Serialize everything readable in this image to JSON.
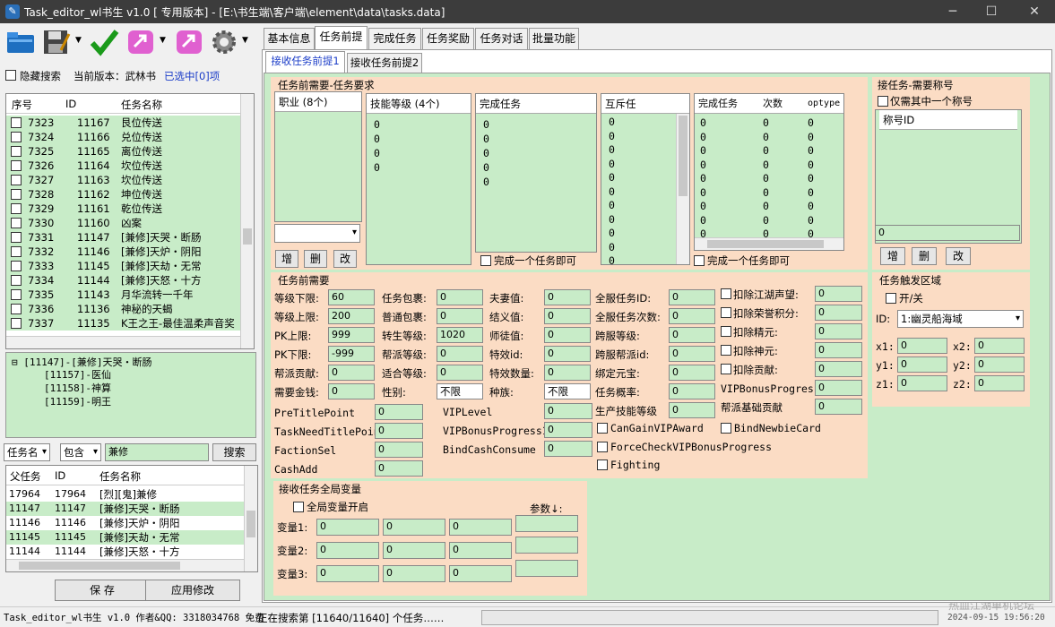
{
  "window": {
    "title": "Task_editor_wl书生 v1.0 [ 专用版本] - [E:\\书生端\\客户端\\element\\data\\tasks.data]",
    "min": "─",
    "max": "☐",
    "close": "✕"
  },
  "toolbar": {
    "hide_search": "隐藏搜索",
    "version_label": "当前版本：武林书",
    "selected": "已选中[0]项"
  },
  "tasklist": {
    "headers": [
      "序号",
      "ID",
      "任务名称"
    ],
    "rows": [
      [
        "7323",
        "11167",
        "艮位传送"
      ],
      [
        "7324",
        "11166",
        "兑位传送"
      ],
      [
        "7325",
        "11165",
        "离位传送"
      ],
      [
        "7326",
        "11164",
        "坎位传送"
      ],
      [
        "7327",
        "11163",
        "坎位传送"
      ],
      [
        "7328",
        "11162",
        "坤位传送"
      ],
      [
        "7329",
        "11161",
        "乾位传送"
      ],
      [
        "7330",
        "11160",
        "凶案"
      ],
      [
        "7331",
        "11147",
        "[兼修]天哭・断肠"
      ],
      [
        "7332",
        "11146",
        "[兼修]天炉・阴阳"
      ],
      [
        "7333",
        "11145",
        "[兼修]天劫・无常"
      ],
      [
        "7334",
        "11144",
        "[兼修]天怒・十方"
      ],
      [
        "7335",
        "11143",
        "月华流转一千年"
      ],
      [
        "7336",
        "11136",
        "神秘的天蝎"
      ],
      [
        "7337",
        "11135",
        "K王之王-最佳温柔声音奖"
      ]
    ]
  },
  "tree": {
    "root": "[11147]-[兼修]天哭・断肠",
    "children": [
      "[11157]-医仙",
      "[11158]-神算",
      "[11159]-明王"
    ]
  },
  "search": {
    "field": "任务名",
    "mode": "包含",
    "text": "兼修",
    "button": "搜索"
  },
  "results": {
    "headers": [
      "父任务",
      "ID",
      "任务名称"
    ],
    "rows": [
      [
        "17964",
        "17964",
        "[烈][鬼]兼修"
      ],
      [
        "11147",
        "11147",
        "[兼修]天哭・断肠"
      ],
      [
        "11146",
        "11146",
        "[兼修]天炉・阴阳"
      ],
      [
        "11145",
        "11145",
        "[兼修]天劫・无常"
      ],
      [
        "11144",
        "11144",
        "[兼修]天怒・十方"
      ]
    ]
  },
  "buttons": {
    "save": "保 存",
    "apply": "应用修改"
  },
  "statusbar": {
    "left": "Task_editor_wl书生 v1.0 作者&QQ: 3318034768 免费",
    "mid": "正在搜索第 [11640/11640] 个任务……",
    "right": "2024-09-15 19:56:20",
    "watermark": "热血江湖单机论坛"
  },
  "tabs": [
    "基本信息",
    "任务前提",
    "完成任务",
    "任务奖励",
    "任务对话",
    "批量功能"
  ],
  "subtabs": [
    "接收任务前提1",
    "接收任务前提2"
  ],
  "req": {
    "title": "任务前需要-任务要求",
    "job_header": "职业 (8个)",
    "skill_header": "技能等级 (4个)",
    "skill_vals": [
      "0",
      "0",
      "0",
      "0"
    ],
    "done_header": "完成任务",
    "done_vals": [
      "0",
      "0",
      "0",
      "0",
      "0"
    ],
    "excl_header": "互斥任",
    "excl_vals": [
      "0",
      "0",
      "0",
      "0",
      "0",
      "0",
      "0",
      "0",
      "0",
      "0",
      "0"
    ],
    "done2_headers": [
      "完成任务",
      "次数",
      "optype"
    ],
    "done2_vals": [
      "0",
      "0",
      "0"
    ],
    "btn_add": "增",
    "btn_del": "删",
    "btn_mod": "改",
    "done_one": "完成一个任务即可",
    "done_one2": "完成一个任务即可"
  },
  "title_req": {
    "title": "接任务-需要称号",
    "only_one": "仅需其中一个称号",
    "header": "称号ID",
    "value": "0"
  },
  "pre": {
    "title": "任务前需要",
    "c1": [
      [
        "等级下限:",
        "60"
      ],
      [
        "等级上限:",
        "200"
      ],
      [
        "PK上限:",
        "999"
      ],
      [
        "PK下限:",
        "-999"
      ],
      [
        "帮派贡献:",
        "0"
      ],
      [
        "需要金钱:",
        "0"
      ]
    ],
    "c2": [
      [
        "任务包裹:",
        "0"
      ],
      [
        "普通包裹:",
        "0"
      ],
      [
        "转生等级:",
        "1020"
      ],
      [
        "帮派等级:",
        "0"
      ],
      [
        "适合等级:",
        "0"
      ],
      [
        "性别:",
        "不限"
      ]
    ],
    "c3": [
      [
        "夫妻值:",
        "0"
      ],
      [
        "结义值:",
        "0"
      ],
      [
        "师徒值:",
        "0"
      ],
      [
        "特效id:",
        "0"
      ],
      [
        "特效数量:",
        "0"
      ],
      [
        "种族:",
        "不限"
      ]
    ],
    "c4": [
      [
        "全服任务ID:",
        "0"
      ],
      [
        "全服任务次数:",
        "0"
      ],
      [
        "跨服等级:",
        "0"
      ],
      [
        "跨服帮派id:",
        "0"
      ],
      [
        "绑定元宝:",
        "0"
      ],
      [
        "任务概率:",
        "0"
      ],
      [
        "生产技能等级",
        "0"
      ]
    ],
    "c5": [
      [
        "扣除江湖声望:",
        "0"
      ],
      [
        "扣除荣誉积分:",
        "0"
      ],
      [
        "扣除精元:",
        "0"
      ],
      [
        "扣除神元:",
        "0"
      ],
      [
        "扣除贡献:",
        "0"
      ]
    ],
    "vip_progress": "VIPBonusProgress",
    "vip_progress_val": "0",
    "guild_base": "帮派基础贡献",
    "guild_base_val": "0",
    "c6": [
      [
        "PreTitlePoint",
        "0"
      ],
      [
        "TaskNeedTitlePoin",
        "0"
      ],
      [
        "FactionSel",
        "0"
      ],
      [
        "CashAdd",
        "0"
      ]
    ],
    "c7": [
      [
        "VIPLevel",
        "0"
      ],
      [
        "VIPBonusProgress1",
        "0"
      ],
      [
        "BindCashConsume",
        "0"
      ]
    ],
    "cb": [
      "CanGainVIPAward",
      "BindNewbieCard",
      "ForceCheckVIPBonusProgress",
      "Fighting"
    ]
  },
  "trigger": {
    "title": "任务触发区域",
    "toggle": "开/关",
    "id_label": "ID:",
    "id_value": "1:幽灵船海域",
    "coords": [
      [
        "x1:",
        "0"
      ],
      [
        "x2:",
        "0"
      ],
      [
        "y1:",
        "0"
      ],
      [
        "y2:",
        "0"
      ],
      [
        "z1:",
        "0"
      ],
      [
        "z2:",
        "0"
      ]
    ]
  },
  "global": {
    "title": "接收任务全局变量",
    "enable": "全局变量开启",
    "param": "参数↓:",
    "vars": [
      [
        "变量1:",
        "0",
        "0",
        "0"
      ],
      [
        "变量2:",
        "0",
        "0",
        "0"
      ],
      [
        "变量3:",
        "0",
        "0",
        "0"
      ]
    ]
  }
}
